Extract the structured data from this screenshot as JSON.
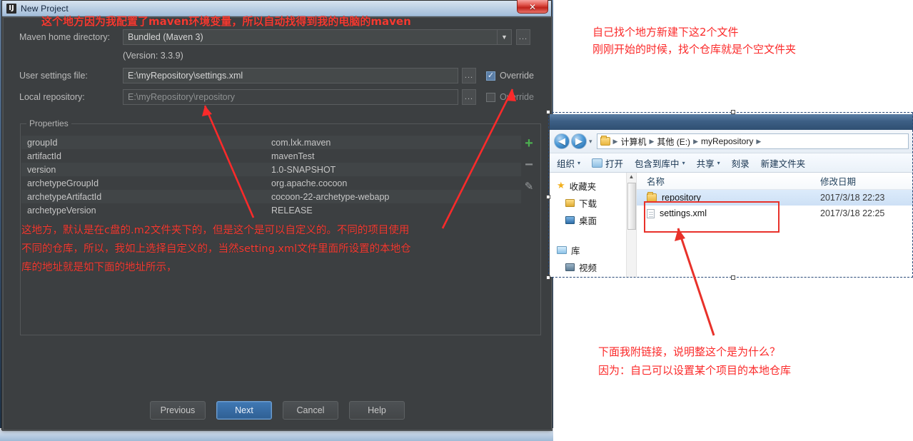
{
  "idea_dialog": {
    "title": "New Project",
    "logo_text": "IJ",
    "close_label": "✕",
    "fields": {
      "maven_home_label": "Maven home directory:",
      "maven_home_value": "Bundled (Maven 3)",
      "version_note": "(Version: 3.3.9)",
      "user_settings_label": "User settings file:",
      "user_settings_value": "E:\\myRepository\\settings.xml",
      "local_repo_label": "Local repository:",
      "local_repo_value": "E:\\myRepository\\repository",
      "ellipsis_label": "...",
      "combo_caret": "▼",
      "override_label": "Override",
      "override_user_settings_checked": true,
      "override_local_repo_checked": false,
      "checkmark": "✓"
    },
    "properties": {
      "legend": "Properties",
      "rows": [
        {
          "key": "groupId",
          "value": "com.lxk.maven"
        },
        {
          "key": "artifactId",
          "value": "mavenTest"
        },
        {
          "key": "version",
          "value": "1.0-SNAPSHOT"
        },
        {
          "key": "archetypeGroupId",
          "value": "org.apache.cocoon"
        },
        {
          "key": "archetypeArtifactId",
          "value": "cocoon-22-archetype-webapp"
        },
        {
          "key": "archetypeVersion",
          "value": "RELEASE"
        }
      ],
      "add_icon": "+",
      "remove_icon": "−",
      "edit_icon": "✎"
    },
    "buttons": {
      "previous": "Previous",
      "next": "Next",
      "cancel": "Cancel",
      "help": "Help"
    }
  },
  "annotations": {
    "top_dialog": "这个地方因为我配置了maven环境变量，所以自动找得到我的电脑的maven",
    "middle_dialog": "这地方，默认是在c盘的.m2文件夹下的，但是这个是可以自定义的。不同的项目使用\n不同的仓库，所以，我如上选择自定义的，当然setting.xml文件里面所设置的本地仓\n库的地址就是如下面的地址所示，",
    "right_top_line1": "自己找个地方新建下这2个文件",
    "right_top_line2": "刚刚开始的时候，找个仓库就是个空文件夹",
    "right_bottom_line1": "下面我附链接，说明整这个是为什么？",
    "right_bottom_line2": "因为：自己可以设置某个项目的本地仓库",
    "arrow_color": "#fb2a2a"
  },
  "explorer": {
    "back_icon": "◀",
    "forward_icon": "▶",
    "nav_dropdown": "▾",
    "breadcrumb": [
      "计算机",
      "其他 (E:)",
      "myRepository"
    ],
    "breadcrumb_sep": "▶",
    "toolbar": [
      {
        "label": "组织",
        "caret": "▾",
        "has_icon": false
      },
      {
        "label": "打开",
        "caret": "",
        "has_icon": true
      },
      {
        "label": "包含到库中",
        "caret": "▾",
        "has_icon": false
      },
      {
        "label": "共享",
        "caret": "▾",
        "has_icon": false
      },
      {
        "label": "刻录",
        "caret": "",
        "has_icon": false
      },
      {
        "label": "新建文件夹",
        "caret": "",
        "has_icon": false
      }
    ],
    "sidebar": [
      {
        "label": "收藏夹",
        "icon": "star-icon"
      },
      {
        "label": "下载",
        "icon": "download-folder-icon"
      },
      {
        "label": "桌面",
        "icon": "desktop-icon"
      },
      {
        "label": "库",
        "icon": "library-icon"
      },
      {
        "label": "视频",
        "icon": "video-icon"
      }
    ],
    "columns": {
      "name": "名称",
      "modified": "修改日期"
    },
    "rows": [
      {
        "name": "repository",
        "modified": "2017/3/18 22:23",
        "type": "folder",
        "selected": true
      },
      {
        "name": "settings.xml",
        "modified": "2017/3/18 22:25",
        "type": "file",
        "selected": false
      }
    ],
    "scroll_up_icon": "▲"
  }
}
